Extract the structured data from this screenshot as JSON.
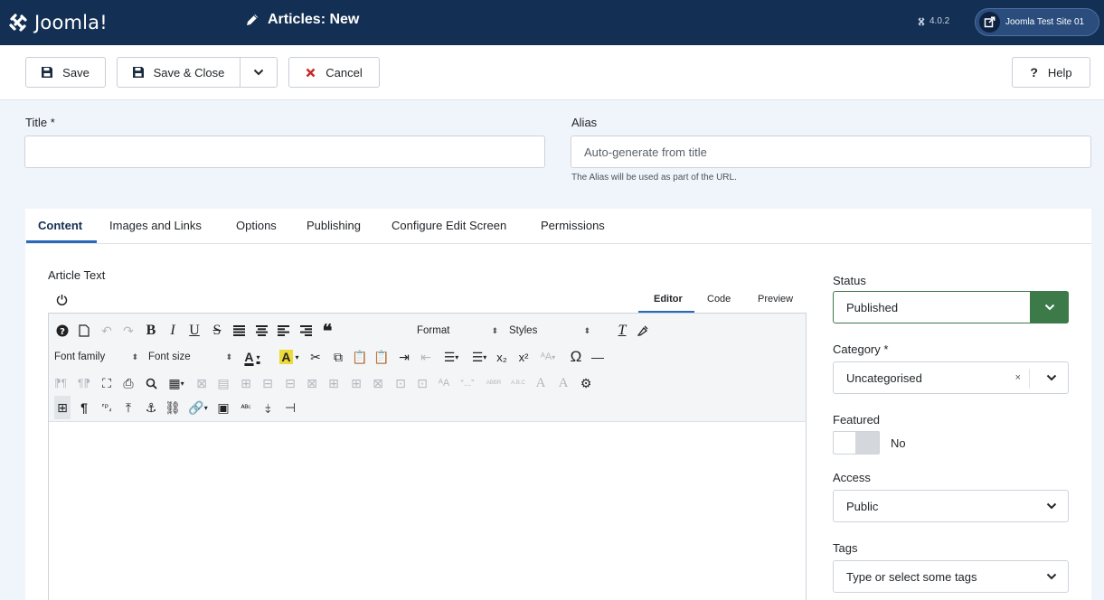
{
  "app": {
    "brand": "Joomla!",
    "page_title": "Articles: New",
    "version": "4.0.2",
    "site_name": "Joomla Test Site 01"
  },
  "toolbar": {
    "save": "Save",
    "save_close": "Save & Close",
    "cancel": "Cancel",
    "help": "Help"
  },
  "form": {
    "title_label": "Title *",
    "title_value": "",
    "alias_label": "Alias",
    "alias_placeholder": "Auto-generate from title",
    "alias_hint": "The Alias will be used as part of the URL."
  },
  "tabs": [
    {
      "label": "Content",
      "active": true
    },
    {
      "label": "Images and Links"
    },
    {
      "label": "Options"
    },
    {
      "label": "Publishing"
    },
    {
      "label": "Configure Edit Screen"
    },
    {
      "label": "Permissions"
    }
  ],
  "editor": {
    "label": "Article Text",
    "modes": [
      "Editor",
      "Code",
      "Preview"
    ],
    "format_select": "Format",
    "styles_select": "Styles",
    "font_family_select": "Font family",
    "font_size_select": "Font size",
    "body": ""
  },
  "sidebar": {
    "status_label": "Status",
    "status_value": "Published",
    "category_label": "Category *",
    "category_value": "Uncategorised",
    "featured_label": "Featured",
    "featured_value": "No",
    "access_label": "Access",
    "access_value": "Public",
    "tags_label": "Tags",
    "tags_placeholder": "Type or select some tags"
  },
  "colors": {
    "header": "#132f53",
    "accent": "#2a69b8",
    "status_green": "#3d7a4a",
    "cancel_red": "#c52827"
  },
  "icons": [
    "joomla-logo",
    "pencil-icon",
    "joomla-version-icon",
    "external-link-icon",
    "save-icon",
    "chevron-down-icon",
    "close-icon",
    "help-icon",
    "power-icon"
  ]
}
